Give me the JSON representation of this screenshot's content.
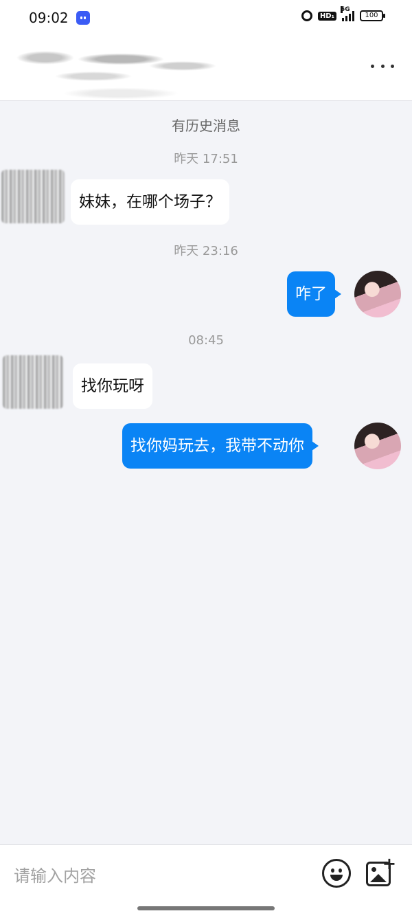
{
  "status_bar": {
    "time": "09:02",
    "network": "5G",
    "hd": "HD₁",
    "battery": "100",
    "icons": [
      "app-icon",
      "alarm-icon",
      "hd-icon",
      "signal-icon",
      "battery-icon"
    ]
  },
  "header": {
    "title": "",
    "menu_icon": "more-icon"
  },
  "chat": {
    "history_label": "有历史消息",
    "messages": [
      {
        "timestamp": "昨天 17:51",
        "side": "left",
        "text": "妹妹，在哪个场子？"
      },
      {
        "timestamp": "昨天 23:16",
        "side": "right",
        "text": "咋了"
      },
      {
        "timestamp": "08:45",
        "side": "left",
        "text": "找你玩呀"
      },
      {
        "side": "right",
        "text": "找你妈玩去，我带不动你"
      }
    ]
  },
  "input": {
    "placeholder": "请输入内容",
    "emoji_icon": "emoji-icon",
    "image_icon": "add-image-icon"
  },
  "colors": {
    "my_bubble": "#0a84f5",
    "their_bubble": "#ffffff",
    "background": "#f3f4f8"
  }
}
